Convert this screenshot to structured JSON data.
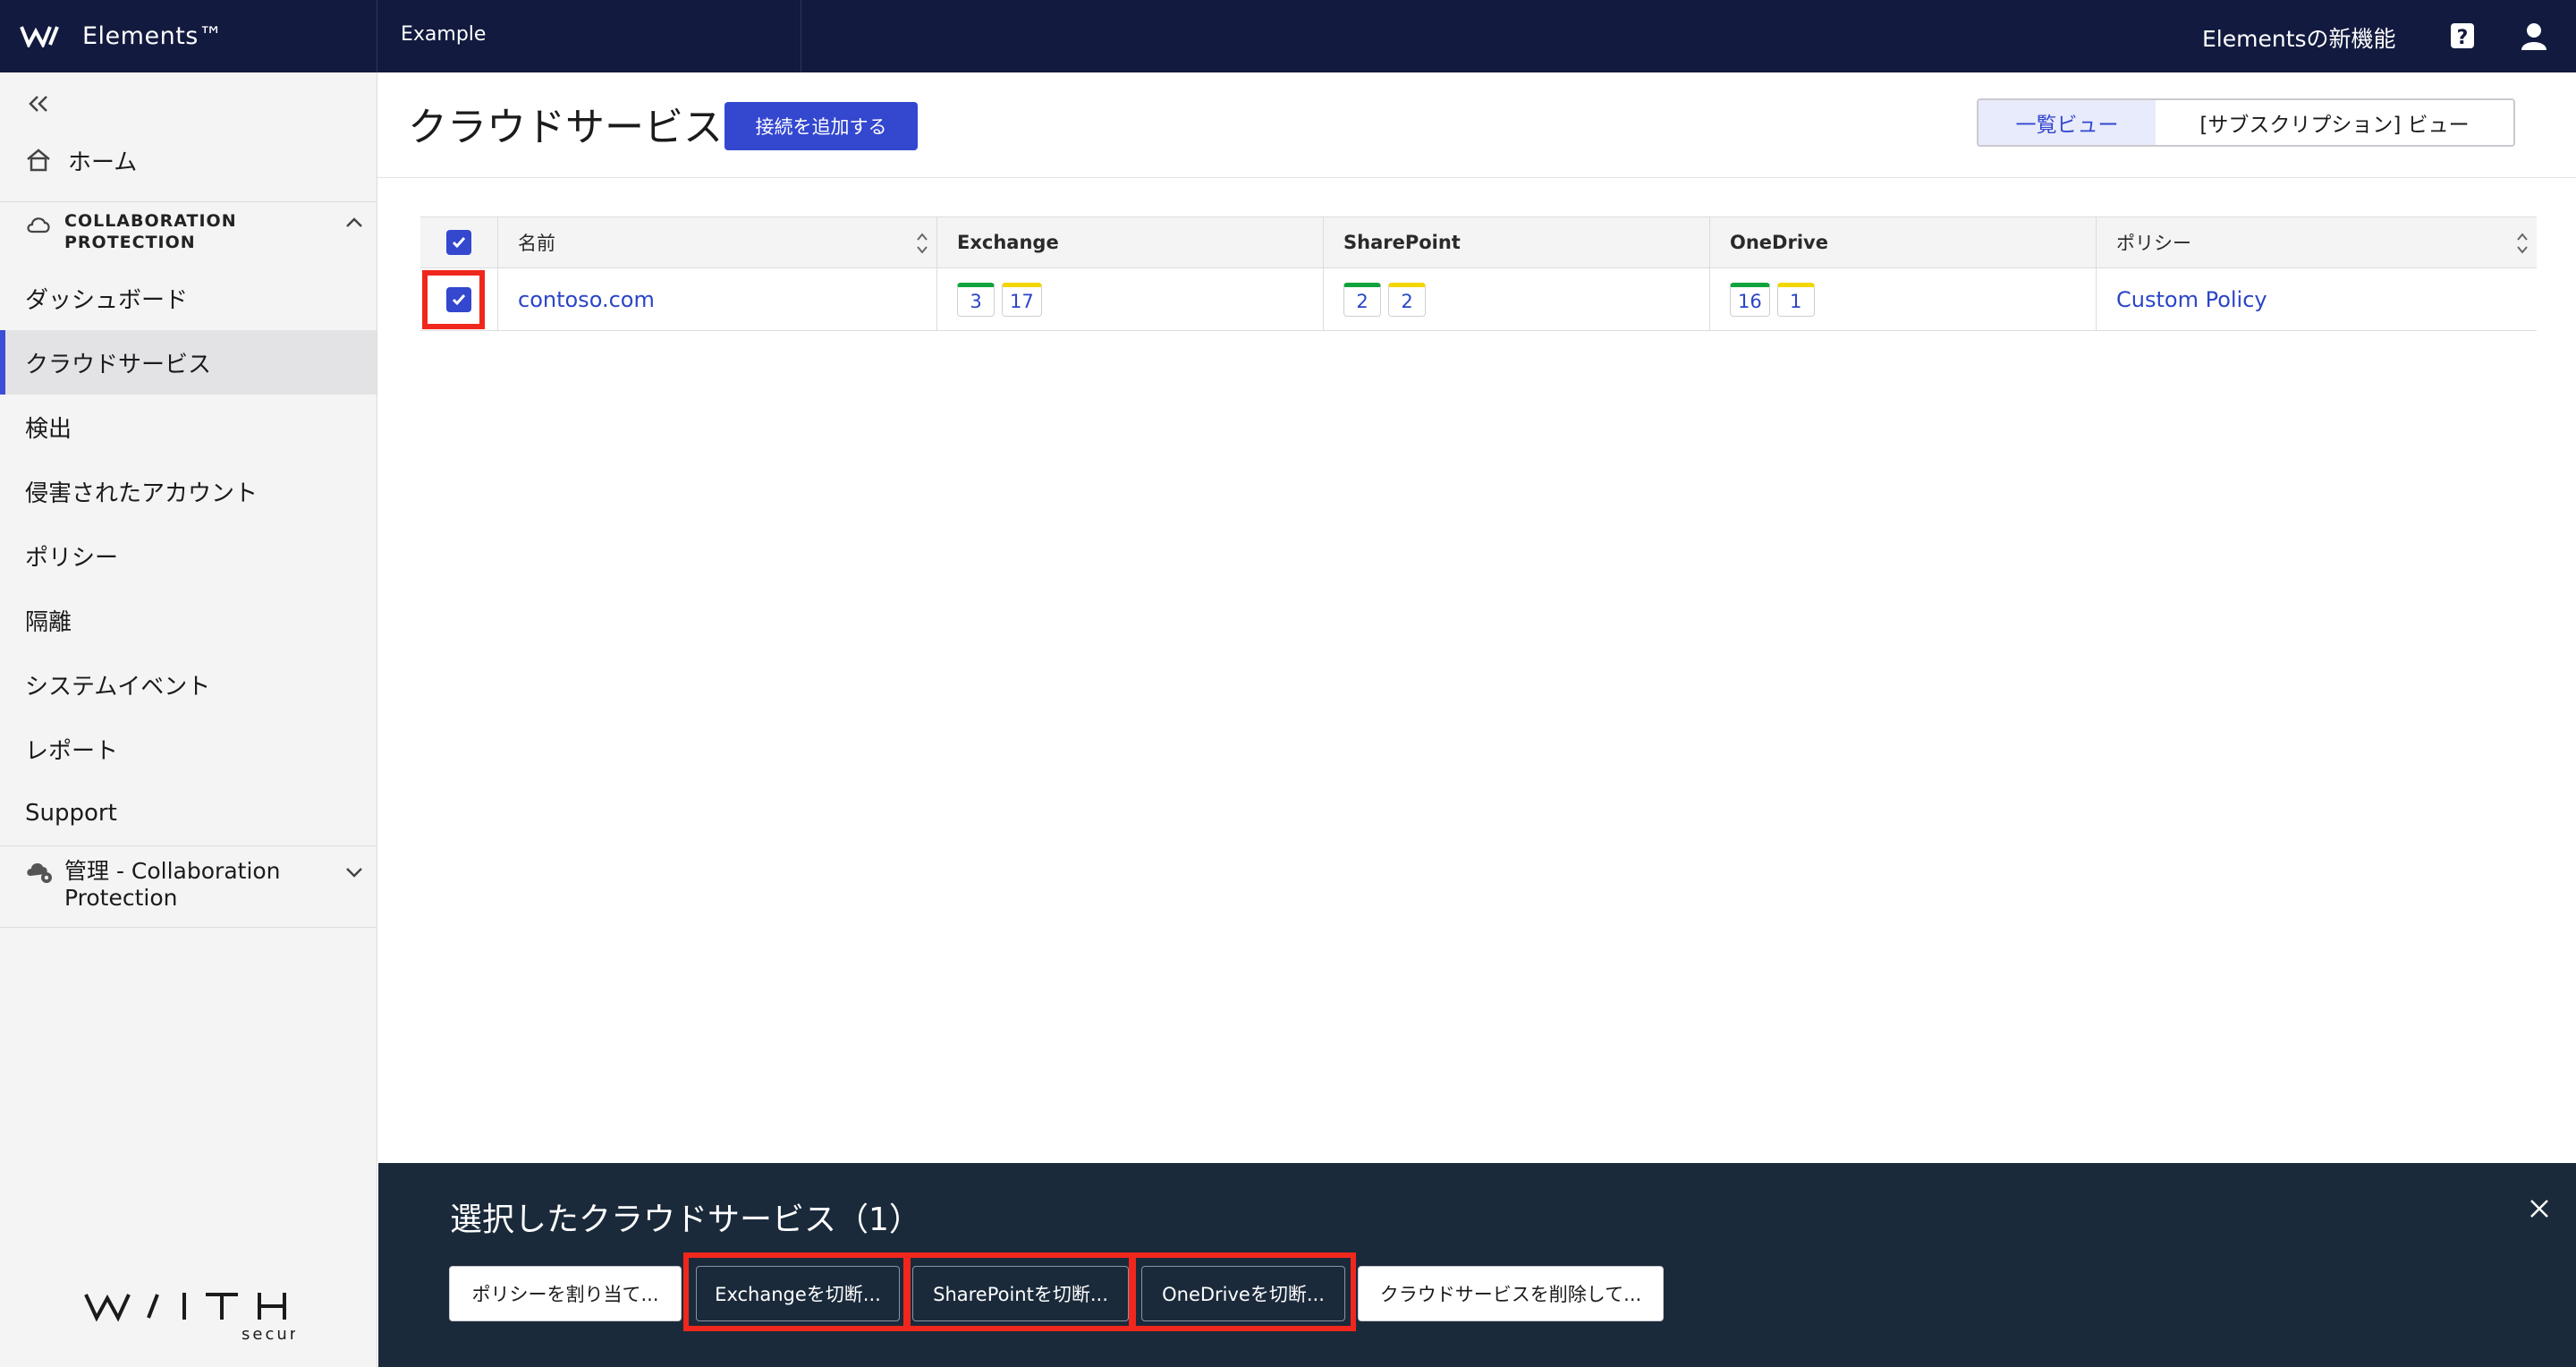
{
  "topbar": {
    "brand": "Elements™",
    "org_name": "Example",
    "whats_new": "Elementsの新機能"
  },
  "sidebar": {
    "home": "ホーム",
    "section_title": "COLLABORATION PROTECTION",
    "items": [
      {
        "label": "ダッシュボード"
      },
      {
        "label": "クラウドサービス"
      },
      {
        "label": "検出"
      },
      {
        "label": "侵害されたアカウント"
      },
      {
        "label": "ポリシー"
      },
      {
        "label": "隔離"
      },
      {
        "label": "システムイベント"
      },
      {
        "label": "レポート"
      },
      {
        "label": "Support"
      }
    ],
    "admin_title": "管理 - Collaboration Protection",
    "footer_brand": "WITH secure"
  },
  "header": {
    "title": "クラウドサービス",
    "add_button": "接続を追加する",
    "view_list": "一覧ビュー",
    "view_subscription": "[サブスクリプション] ビュー"
  },
  "table": {
    "columns": [
      "名前",
      "Exchange",
      "SharePoint",
      "OneDrive",
      "ポリシー"
    ],
    "rows": [
      {
        "name": "contoso.com",
        "exchange": [
          "3",
          "17"
        ],
        "sharepoint": [
          "2",
          "2"
        ],
        "onedrive": [
          "16",
          "1"
        ],
        "policy": "Custom Policy"
      }
    ]
  },
  "bottom_panel": {
    "title": "選択したクラウドサービス（1）",
    "actions": [
      "ポリシーを割り当て...",
      "Exchangeを切断...",
      "SharePointを切断...",
      "OneDriveを切断...",
      "クラウドサービスを削除して..."
    ]
  },
  "colors": {
    "topbar_bg": "#121a3f",
    "accent": "#3347cf",
    "highlight": "#f0271c",
    "panel_bg": "#1b2a3b",
    "badge_green": "#10a33c",
    "badge_yellow": "#f2d600"
  }
}
